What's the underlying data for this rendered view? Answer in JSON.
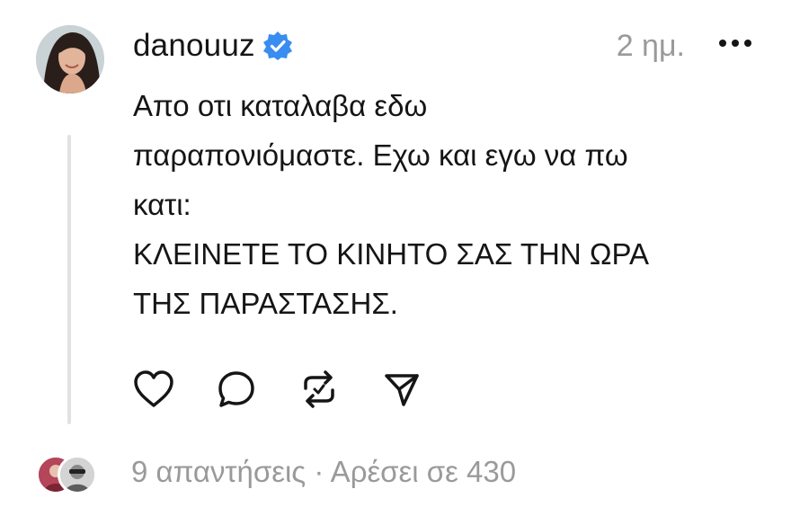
{
  "post": {
    "username": "danouuz",
    "verified_icon": "verified-badge-icon",
    "timestamp": "2 ημ.",
    "more_icon": "more-options-icon",
    "body_lines": [
      "Απο οτι καταλαβα εδω",
      "παραπονιόμαστε. Εχω και εγω να πω",
      "κατι:",
      "ΚΛΕΙΝΕΤΕ ΤΟ ΚΙΝΗΤΟ ΣΑΣ ΤΗΝ ΩΡΑ",
      "ΤΗΣ ΠΑΡΑΣΤΑΣΗΣ."
    ],
    "actions": [
      "heart-icon",
      "comment-icon",
      "repost-icon",
      "share-icon"
    ]
  },
  "footer": {
    "summary": "9 απαντήσεις · Αρέσει σε 430"
  },
  "colors": {
    "text": "#151515",
    "muted": "#9a9a9a",
    "verified": "#3a8df0",
    "thread_line": "#e2e2e2"
  }
}
